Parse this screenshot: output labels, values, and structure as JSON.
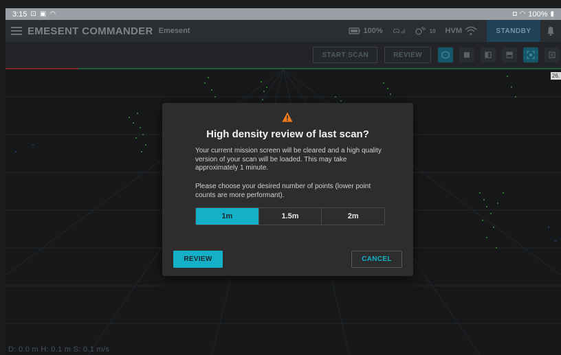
{
  "status_bar": {
    "time": "3:15",
    "battery_text": "100%"
  },
  "app_bar": {
    "title": "EMESENT COMMANDER",
    "subtitle": "Emesent",
    "battery_level": "100%",
    "gnss_count": "10",
    "network_label": "HVM",
    "state_label": "STANDBY"
  },
  "toolbar": {
    "start_scan_label": "START SCAN",
    "review_label": "REVIEW"
  },
  "viewport": {
    "scale_badge": "26.",
    "readout": "D: 0.0 m  H: 0.1 m  S: 0.1 m/s"
  },
  "dialog": {
    "title": "High density review of last scan?",
    "body_1": "Your current mission screen will be cleared and a high quality version of your scan will be loaded. This may take approximately 1 minute.",
    "body_2": "Please choose your desired number of points (lower point counts are more performant).",
    "options": [
      "1m",
      "1.5m",
      "2m"
    ],
    "selected_option": "1m",
    "review_label": "REVIEW",
    "cancel_label": "CANCEL"
  },
  "colors": {
    "accent": "#13b0c7",
    "warning": "#f07b1d",
    "standby_bg": "#1f4258"
  }
}
